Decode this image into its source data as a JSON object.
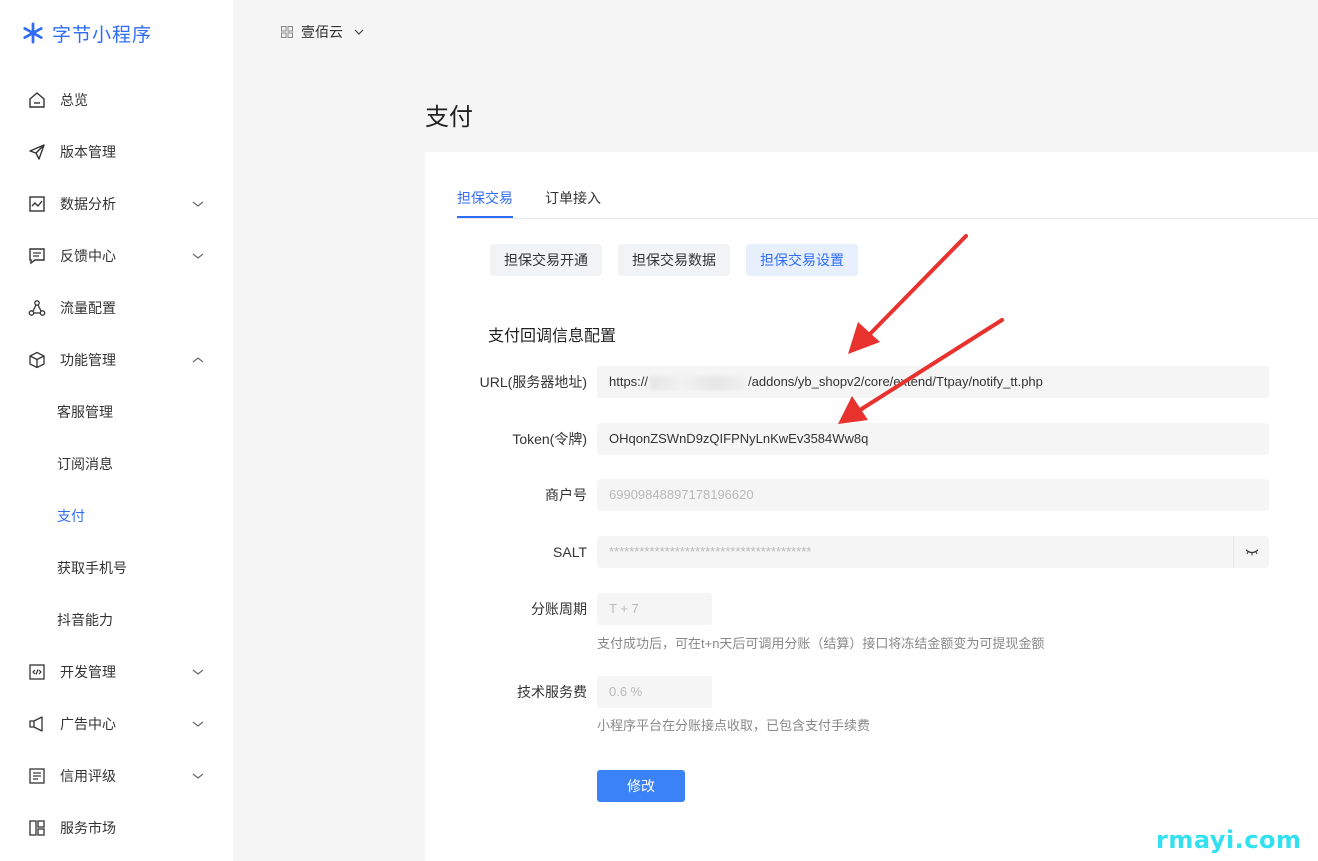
{
  "brand": {
    "name": "字节小程序",
    "color": "#2f6df6"
  },
  "app_switcher": {
    "name": "壹佰云"
  },
  "sidebar": {
    "items": [
      {
        "label": "总览",
        "icon": "home-icon"
      },
      {
        "label": "版本管理",
        "icon": "paper-plane-icon"
      },
      {
        "label": "数据分析",
        "icon": "chart-icon",
        "expandable": true
      },
      {
        "label": "反馈中心",
        "icon": "message-icon",
        "expandable": true
      },
      {
        "label": "流量配置",
        "icon": "share-icon"
      },
      {
        "label": "功能管理",
        "icon": "cube-icon",
        "expandable": true,
        "expanded": true
      },
      {
        "label": "客服管理",
        "sub": true
      },
      {
        "label": "订阅消息",
        "sub": true
      },
      {
        "label": "支付",
        "sub": true,
        "active": true
      },
      {
        "label": "获取手机号",
        "sub": true
      },
      {
        "label": "抖音能力",
        "sub": true
      },
      {
        "label": "开发管理",
        "icon": "code-icon",
        "expandable": true
      },
      {
        "label": "广告中心",
        "icon": "megaphone-icon",
        "expandable": true
      },
      {
        "label": "信用评级",
        "icon": "document-icon",
        "expandable": true
      },
      {
        "label": "服务市场",
        "icon": "grid-layout-icon"
      }
    ]
  },
  "page": {
    "title": "支付"
  },
  "tabs": [
    {
      "label": "担保交易",
      "active": true
    },
    {
      "label": "订单接入",
      "active": false
    }
  ],
  "subtabs": [
    {
      "label": "担保交易开通",
      "active": false
    },
    {
      "label": "担保交易数据",
      "active": false
    },
    {
      "label": "担保交易设置",
      "active": true
    }
  ],
  "form": {
    "section_title": "支付回调信息配置",
    "url": {
      "label": "URL(服务器地址)",
      "value_prefix": "https://",
      "value_suffix": "/addons/yb_shopv2/core/extend/Ttpay/notify_tt.php"
    },
    "token": {
      "label": "Token(令牌)",
      "value": "OHqonZSWnD9zQIFPNyLnKwEv3584Ww8q"
    },
    "merchant": {
      "label": "商户号",
      "value": "69909848897178196620"
    },
    "salt": {
      "label": "SALT",
      "value": "****************************************"
    },
    "cycle": {
      "label": "分账周期",
      "value": "T + 7",
      "hint": "支付成功后，可在t+n天后可调用分账（结算）接口将冻结金额变为可提现金额"
    },
    "fee": {
      "label": "技术服务费",
      "value": "0.6 %",
      "hint": "小程序平台在分账接点收取，已包含支付手续费"
    },
    "submit_label": "修改"
  },
  "annotation_color": "#e8322e",
  "watermark": "rmayi.com"
}
